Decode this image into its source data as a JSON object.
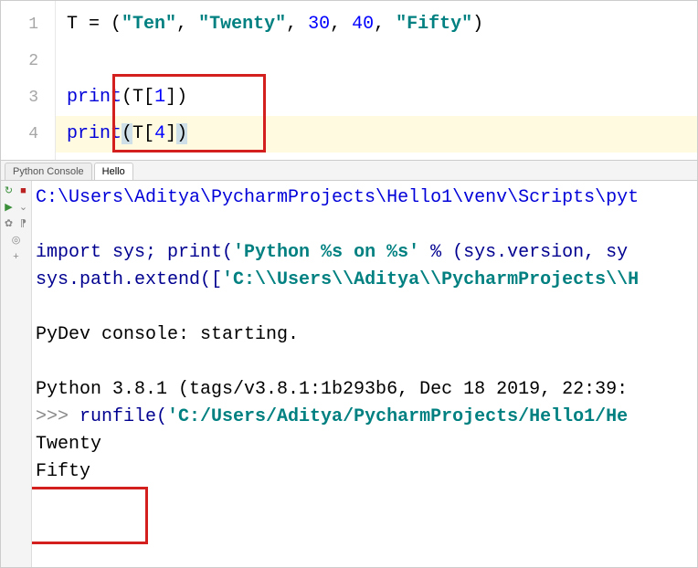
{
  "editor": {
    "gutter": [
      "1",
      "2",
      "3",
      "4"
    ],
    "line1": {
      "var": "T",
      "eq": " = (",
      "s1": "\"Ten\"",
      "c1": ", ",
      "s2": "\"Twenty\"",
      "c2": ", ",
      "n1": "30",
      "c3": ", ",
      "n2": "40",
      "c4": ", ",
      "s3": "\"Fifty\"",
      "close": ")"
    },
    "line3": {
      "call": "print",
      "open": "(",
      "var": "T",
      "lb": "[",
      "idx": "1",
      "rb": "]",
      "close": ")"
    },
    "line4": {
      "call": "print",
      "open_sel": "(",
      "var": "T",
      "lb": "[",
      "idx": "4",
      "rb": "]",
      "close_sel": ")"
    }
  },
  "tabs": {
    "console": "Python Console",
    "hello": "Hello"
  },
  "toolbar": {
    "rerun": "↻",
    "stop": "■",
    "run": "▶",
    "debug": "⌄",
    "settings": "✿",
    "softwrap": "⁋",
    "scroll": "◎",
    "add": "+"
  },
  "console": {
    "path": "C:\\Users\\Aditya\\PycharmProjects\\Hello1\\venv\\Scripts\\pyt",
    "import1": "import sys; print(",
    "import_str": "'Python %s on %s'",
    "import2": " % (sys.version, sy",
    "syspath1": "sys.path.extend([",
    "syspath_str": "'C:\\\\Users\\\\Aditya\\\\PycharmProjects\\\\H",
    "pydev": "PyDev console: starting.",
    "pyver": "Python 3.8.1 (tags/v3.8.1:1b293b6, Dec 18 2019, 22:39:",
    "prompt": ">>> ",
    "runfile1": "runfile(",
    "runfile_str": "'C:/Users/Aditya/PycharmProjects/Hello1/He",
    "out1": "Twenty",
    "out2": "Fifty"
  }
}
